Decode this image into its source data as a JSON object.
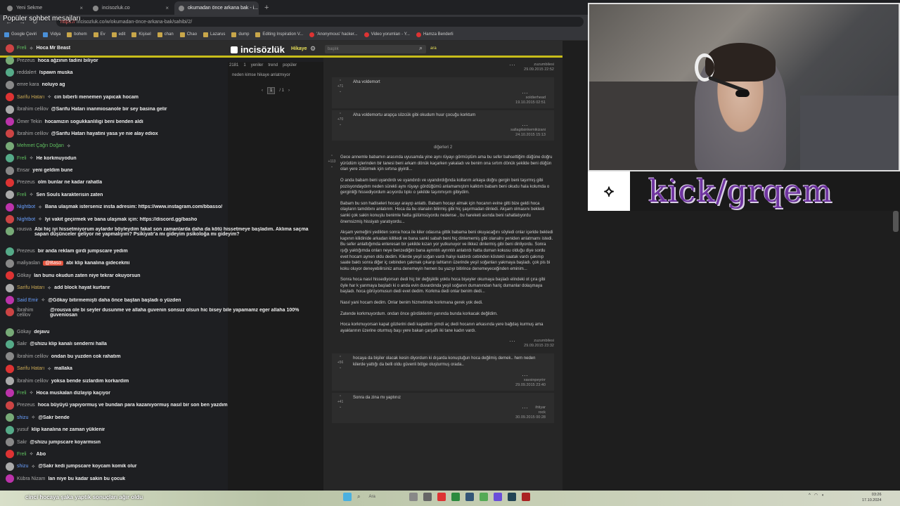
{
  "browser": {
    "tabs": [
      {
        "label": "Yeni Sekme"
      },
      {
        "label": "incisozluk.co"
      },
      {
        "label": "okumadan önce arkana bak - i..."
      }
    ],
    "url_scheme": "https://",
    "url": "incisozluk.co/w/okumadan-önce-arkana-bak/sahibi/2/",
    "bookmarks": [
      "Google Çeviri",
      "Vidya",
      "bohem",
      "Ev",
      "edit",
      "Kişisel",
      "chan",
      "Chao",
      "Lazarus",
      "dump",
      "Editing Inspiration V...",
      "'Anonymous' hacker...",
      "Video yorumları - Y...",
      "Hamza Benderli"
    ]
  },
  "chat": {
    "title": "Popüler sohbet mesajları",
    "messages": [
      {
        "user": "Freli",
        "text": "Hoca Mr Beast",
        "uc": "g"
      },
      {
        "user": "Prezeus",
        "text": "hoca ağzının tadini biliyor",
        "uc": ""
      },
      {
        "user": "reddalert",
        "text": "/spawn muska",
        "uc": ""
      },
      {
        "user": "emre kara",
        "text": "noluyo ag",
        "uc": ""
      },
      {
        "user": "Sarifu Hatarı",
        "text": "cin biberli menemen yapıcak hocam",
        "uc": "y"
      },
      {
        "user": "İbrahim celilov",
        "text": "@Sarifu Hatarı inanmiosanole bir sey basina gelir",
        "uc": ""
      },
      {
        "user": "Ömer Tekin",
        "text": "hocamızın sogukkanliligi beni benden aldi",
        "uc": ""
      },
      {
        "user": "İbrahim celilov",
        "text": "@Sarifu Hatarı hayatini yasa ye nie alay ediox",
        "uc": ""
      },
      {
        "user": "Mehmet Çağrı Doğan",
        "text": "",
        "uc": "g"
      },
      {
        "user": "Freli",
        "text": "He korkmuyodun",
        "uc": "g"
      },
      {
        "user": "Ensar",
        "text": "yeni geldim bune",
        "uc": ""
      },
      {
        "user": "Prezeus",
        "text": "olm bunlar ne kadar rahatla",
        "uc": ""
      },
      {
        "user": "Freli",
        "text": "Sen Souls karakterisin zaten",
        "uc": "g"
      },
      {
        "user": "Nightbot",
        "text": "Bana ulaşmak isterseniz insta adresim: https://www.instagram.com/bbasso/",
        "uc": "b"
      },
      {
        "user": "Nightbot",
        "text": "İyi vakit geçirmek ve bana ulaşmak için: https://discord.gg/basho",
        "uc": "b"
      },
      {
        "user": "rousva",
        "text": "Abi hiç iyi hissetmiyorum aylardır böyleydim fakat son zamanlarda daha da kötü hissetmeye başladım. Aklıma saçma sapan düşünceler geliyor ne yapmalıyım? Psikiyatr'a mı gideyim psikoloğa mı gideyim?",
        "uc": "",
        "two": true
      },
      {
        "user": "Prezeus",
        "text": "bir anda reklam girdi jumpscare yedim",
        "uc": ""
      },
      {
        "user": "maliyaslan",
        "text": "abi klip kanalına gidecekmi",
        "uc": "",
        "hl": "@Baso"
      },
      {
        "user": "Gökay",
        "text": "lan bunu okudun zaten niye tekrar okuyorsun",
        "uc": ""
      },
      {
        "user": "Sarifu Hatarı",
        "text": "add block hayat kurtarır",
        "uc": "y"
      },
      {
        "user": "Said Emir",
        "text": "@Gökay bitirmemişti daha önce baştan başladı o yüzden",
        "uc": "b"
      },
      {
        "user": "İbrahim celilov",
        "text": "@rousva ole bi seyler dusunme ve allaha guvenin sonsuz olsun hic bisey bile yapamamz eger allaha 100% guveniosan",
        "uc": "",
        "two": true
      },
      {
        "user": "Gökay",
        "text": "dejavu",
        "uc": ""
      },
      {
        "user": "Sakr",
        "text": "@shizu klip kanalı senderni halla",
        "uc": ""
      },
      {
        "user": "İbrahim celilov",
        "text": "ondan bu yuzden cok rahatım",
        "uc": ""
      },
      {
        "user": "Sarifu Hatarı",
        "text": "mallaka",
        "uc": "y"
      },
      {
        "user": "İbrahim celilov",
        "text": "yoksa bende sizlardim korkardim",
        "uc": ""
      },
      {
        "user": "Freli",
        "text": "Hoca muskalan dizlayip kaçıyor",
        "uc": "g"
      },
      {
        "user": "Prezeus",
        "text": "hoca büyüyü yapıyormuş ve bundan para kazanıyormuş nasıl bir son ben yazdım",
        "uc": ""
      },
      {
        "user": "shizu",
        "text": "@Sakr bende",
        "uc": "b"
      },
      {
        "user": "yusuf",
        "text": "klip kanalına ne zaman yüklenir",
        "uc": ""
      },
      {
        "user": "Sakr",
        "text": "@shizu jumpscare koyarmısın",
        "uc": ""
      },
      {
        "user": "Freli",
        "text": "Abo",
        "uc": "g"
      },
      {
        "user": "shizu",
        "text": "@Sakr kedi jumpscare koycam komik olur",
        "uc": "b"
      },
      {
        "user": "Kübra Nizam",
        "text": "lan niye bu kadar sakin bu çocuk",
        "uc": ""
      }
    ]
  },
  "site": {
    "logo": "incisözlük",
    "nav_hikaye": "Hikaye",
    "search_placeholder": "başlık",
    "search_button": "ara",
    "stats": [
      "2181",
      "1",
      "yeniler",
      "trend",
      "popüler"
    ],
    "topic": "neden kimse hikaye anlatmıyor",
    "pager": {
      "current": "1",
      "total": "/ 1"
    },
    "entries": [
      {
        "vote": "",
        "paras": [],
        "author": "zuzumbilesi",
        "date": "29.09.2015 22:52"
      },
      {
        "vote": "+71",
        "paras": [
          "Aha voldemort"
        ],
        "author": "soldierhead",
        "date": "19.10.2015 02:51",
        "boxed": true
      },
      {
        "vote": "+70",
        "paras": [
          "Aha voldemortu arapça sözcük gibi okudum huur çocuğu korktum"
        ],
        "author": "sallagitsinkemikizani",
        "date": "24.10.2015 15:13",
        "boxed": true
      },
      {
        "divider": "diğerleri 2"
      },
      {
        "vote": "+113",
        "paras": [
          "Gece annemle babamın arasında uyusamda yine aynı rüyayı görmüştüm ama bu sefer bahsettiğim düğüne doğru yürüdüm içlerinden bir tanesi beni arkam dönük kaçarken yakaladı ve benim ona sırtım dönük şekilde beni düğün olan yere zütürmek için sırtına giyirdi...",
          "O anda babam beni uyandırdı ve uyandırdı ve uyandırdığında kollarım arkaya doğru gergin beni taşırmış gibi pozisyondaydım neden sürekli aynı rüyayı gördüğümü anlamamıştım kalktım babam beni okudu hala kolumda o gerginliği hissediyordum acıyordu tıpkı o şekilde taşınmışım gibiydim.",
          "Babam bu son hadiseleri hocayı arayıp anlattı. Babam hocayı almak için hocanın evine gitti bize geldi hoca olayların tamdıbını anlatırım. Hoca da bu olanalın bilirmiş gibi hiç şaşırmadan dinledi. Akşam olmasını bekledi sanki çok sakin konuştu benimle hatta gülümsüyordu nedense , bu hareketi asında beni rahatlatıyordu önemsizmiş hissiyatı yaratıyordu...",
          "Akşam yemeğini yedikten sonra hoca ile kiler odasına gittik babama beni okuyacağını söyledi onlar içeride bekledi kapının kilidinide arkadan kilitledi ve bana sanki sabah beni hiç dinlememiş gibi olanalrıı yeniden anlatmamı istedi. Bu sefer anlattığımda enteresan bir şekilde kızarı yor yutkunuyor ve ilkkez dinlermiş gibi beni dinliyordu. Sonra ışığı yaktığımda onları neye benzediğini bana ayrıntılı ayrıntılı anlatırdı hatta duman kokusu olduğu diye sordu evet hocam aynen oldu dedim. Kilerde yeşil soğan vardı halıyı kaldırdı cebinden köstekli saatak vardı çakınıp saate baktı sonra diğer iç cebinden çakmak çıkarıp tahtanın üzerinde yeşil soğanları yakmaya başladı. çok pis bi koku oluyor deneyebilirsiniz ama denemeyin hemen bu yazıyı bitirince denemeyeceğinden eminim...",
          "Sonra hoca nasıl hissediyorsun dedi hiç bir değişiklik yoktu hoca bişeyler okumaya başladı elindeki ot çıra gibi öyle har k yanmaya başladı ki o anda evin duvardında yeşil soğanın dumanından hariç dumanlar dolaşmaya başladı. hoca görüyomusun dedi evet dedim. Korkma dedi onlar benim dedi...",
          "Nasıl yani hocam dedim. Onlar benim hizmetimde korkmana gerek yok dedi.",
          "Zatende korkmuyordum. ondan önce gördüklerim yanında bunda korkacak değildim.",
          "Hoca korkmuyorsan kapat gözlerini dedi kapattım şimdi aç dedi hocanın arkasında yere bağdaş kurmuş ama ayaklarının üzerine oturmuş başı yere bakan çarşaflı iki tane kadın vardı."
        ],
        "author": "zuzumbilesi",
        "date": "29.09.2015 23:32"
      },
      {
        "vote": "+56",
        "paras": [
          "hocaya da bişiler olacak kesin diyordum ki dışarda konuştuğun hoca değilmiş demek.. hem neden kilerde yattığı da belli oldu güvenli bölge oluşturmuş orada.."
        ],
        "author": "xavsinpeyrirr",
        "date": "29.09.2015 23:40",
        "boxed": true
      },
      {
        "vote": "+41",
        "paras": [
          "Sonra da zina mı yaptınız"
        ],
        "author": "ihtiyar rock",
        "date": "30.09.2015 00:28",
        "boxed": true
      }
    ]
  },
  "stream": {
    "kick_text": "kick/grqem"
  },
  "taskbar": {
    "caption": "cinci hocaya şaka yaptık sonuçları ağır oldu",
    "search": "Ara",
    "time": "03:26",
    "date": "17.10.2024"
  }
}
